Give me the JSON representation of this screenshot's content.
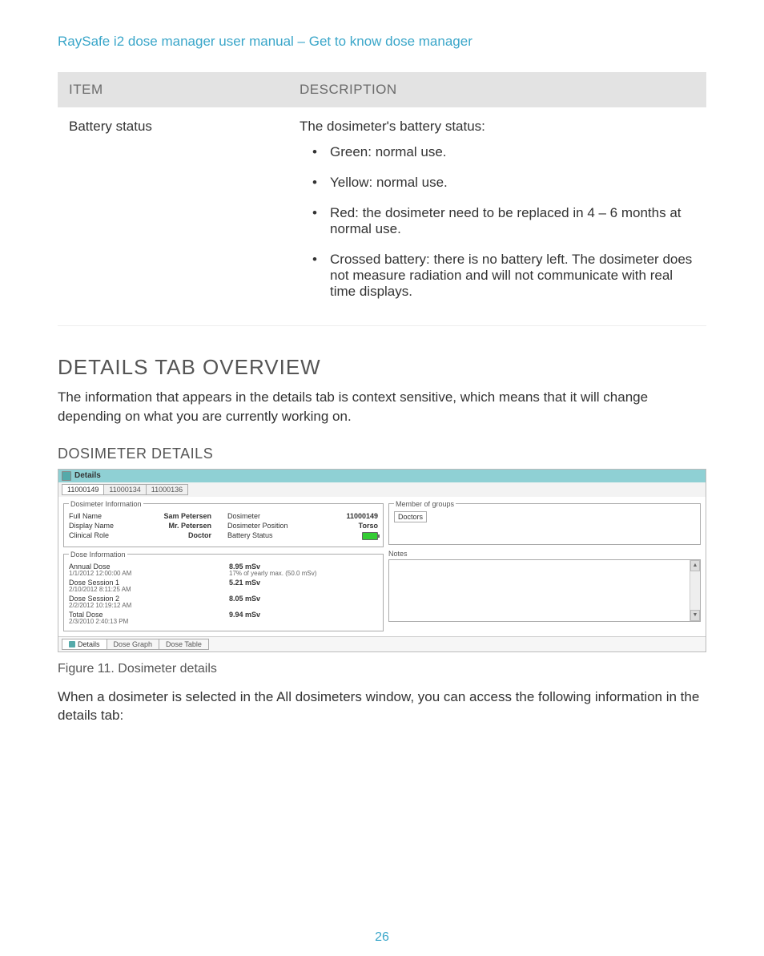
{
  "header": {
    "breadcrumb": "RaySafe i2 dose manager user manual – Get to know dose manager"
  },
  "table": {
    "headers": {
      "item": "ITEM",
      "description": "DESCRIPTION"
    },
    "rows": [
      {
        "item": "Battery status",
        "intro": "The dosimeter's battery status:",
        "bullets": [
          "Green: normal use.",
          "Yellow: normal use.",
          "Red: the dosimeter need to be replaced in 4 – 6 months at normal use.",
          "Crossed battery: there is no battery left. The dosimeter does not measure radiation and will not communicate with real time displays."
        ]
      }
    ]
  },
  "section": {
    "title": "DETAILS TAB OVERVIEW",
    "intro": "The information that appears in the details tab is context sensitive, which means that it will change depending on what you are currently working on.",
    "subtitle": "DOSIMETER DETAILS",
    "caption": "Figure 11.    Dosimeter details",
    "following": "When a dosimeter is selected in the All dosimeters window, you can access the following information in the details tab:"
  },
  "panel": {
    "title": "Details",
    "tabs": [
      "11000149",
      "11000134",
      "11000136"
    ],
    "dosimeter_info": {
      "legend": "Dosimeter Information",
      "fields": [
        {
          "label": "Full Name",
          "value": "Sam Petersen",
          "label2": "Dosimeter",
          "value2": "11000149"
        },
        {
          "label": "Display Name",
          "value": "Mr. Petersen",
          "label2": "Dosimeter Position",
          "value2": "Torso"
        },
        {
          "label": "Clinical Role",
          "value": "Doctor",
          "label2": "Battery Status",
          "value2": "battery"
        }
      ]
    },
    "dose_info": {
      "legend": "Dose Information",
      "rows": [
        {
          "label": "Annual Dose",
          "sub": "1/1/2012 12:00:00 AM",
          "value": "8.95 mSv",
          "extra": "17%  of yearly max.  (50.0 mSv)"
        },
        {
          "label": "Dose Session 1",
          "sub": "2/10/2012 8:11:25 AM",
          "value": "5.21 mSv"
        },
        {
          "label": "Dose Session 2",
          "sub": "2/2/2012 10:19:12 AM",
          "value": "8.05 mSv"
        },
        {
          "label": "Total Dose",
          "sub": "2/3/2010 2:40:13 PM",
          "value": "9.94 mSv"
        }
      ]
    },
    "groups": {
      "legend": "Member of groups",
      "items": [
        "Doctors"
      ]
    },
    "notes": {
      "legend": "Notes"
    },
    "bottom_tabs": [
      "Details",
      "Dose Graph",
      "Dose Table"
    ]
  },
  "page_number": "26"
}
